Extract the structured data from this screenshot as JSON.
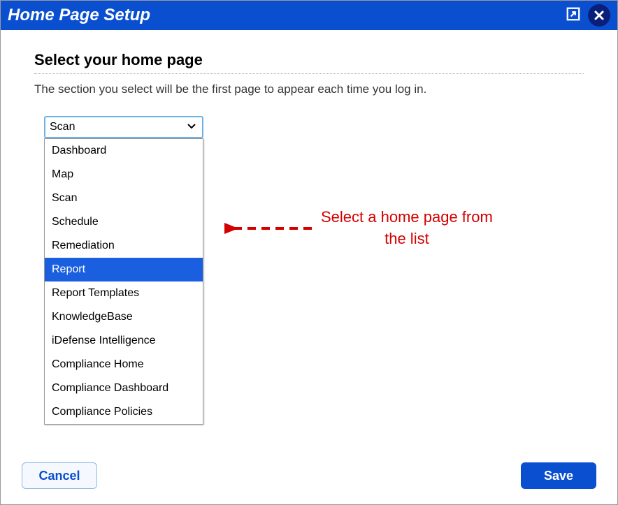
{
  "header": {
    "title": "Home Page Setup"
  },
  "section": {
    "title": "Select your home page",
    "description": "The section you select will be the first page to appear each time you log in."
  },
  "select": {
    "value": "Scan",
    "options": [
      "Dashboard",
      "Map",
      "Scan",
      "Schedule",
      "Remediation",
      "Report",
      "Report Templates",
      "KnowledgeBase",
      "iDefense Intelligence",
      "Compliance Home",
      "Compliance Dashboard",
      "Compliance Policies"
    ],
    "highlighted_index": 5
  },
  "annotation": {
    "text": "Select a home page from the list"
  },
  "footer": {
    "cancel": "Cancel",
    "save": "Save"
  }
}
